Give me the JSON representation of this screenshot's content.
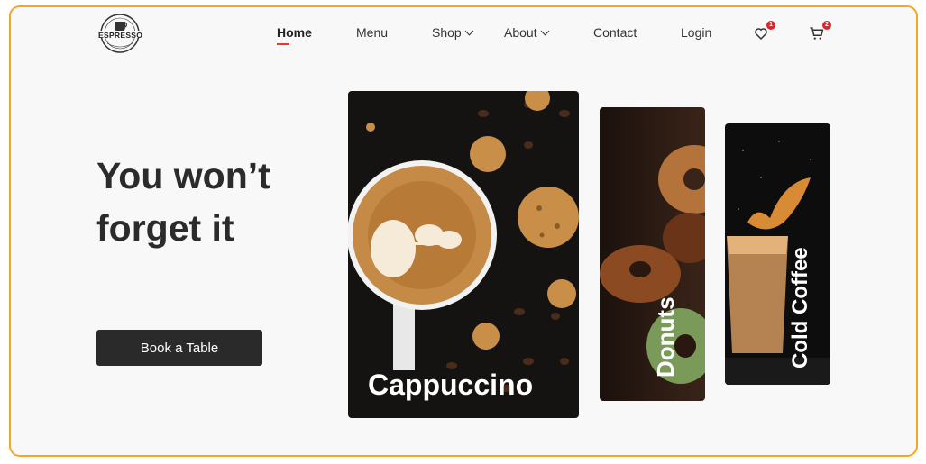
{
  "logo": {
    "top_text": "COFFEE SHOP",
    "name": "ESPRESSO",
    "icon": "coffee-cup-emblem"
  },
  "nav": {
    "items": [
      {
        "label": "Home",
        "active": true
      },
      {
        "label": "Menu"
      },
      {
        "label": "Shop",
        "dropdown": true
      },
      {
        "label": "About",
        "dropdown": true
      },
      {
        "label": "Contact"
      },
      {
        "label": "Login"
      }
    ],
    "wishlist": {
      "icon": "heart-icon",
      "count": "1"
    },
    "cart": {
      "icon": "cart-icon",
      "count": "2"
    }
  },
  "hero": {
    "title": "You won’t forget it",
    "cta": "Book a Table"
  },
  "cards": [
    {
      "label": "Cappuccino"
    },
    {
      "label": "Donuts"
    },
    {
      "label": "Cold Coffee"
    }
  ],
  "colors": {
    "frame_border": "#f5a623",
    "accent": "#e33333",
    "badge": "#e0242a",
    "button": "#2a2a2a"
  }
}
